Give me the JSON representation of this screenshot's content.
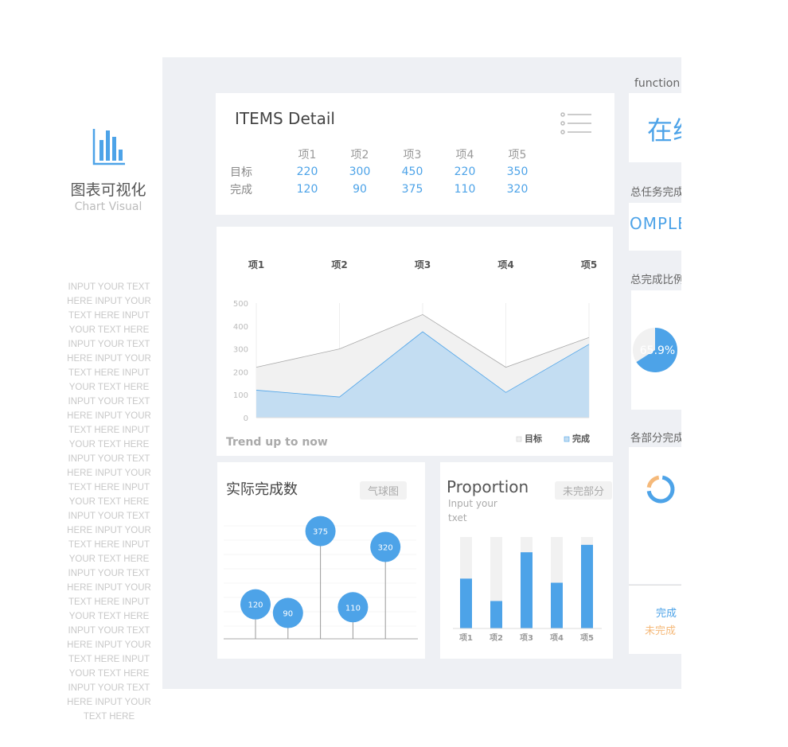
{
  "sidebar": {
    "title": "图表可视化",
    "subtitle": "Chart Visual",
    "icon": "bar-chart-icon",
    "body": "INPUT YOUR TEXT HERE INPUT YOUR TEXT HERE INPUT YOUR TEXT HERE INPUT YOUR TEXT HERE INPUT YOUR TEXT HERE INPUT YOUR TEXT HERE INPUT YOUR TEXT HERE INPUT YOUR TEXT HERE INPUT YOUR TEXT HERE INPUT YOUR TEXT HERE INPUT YOUR TEXT HERE INPUT YOUR TEXT HERE INPUT YOUR TEXT HERE INPUT YOUR TEXT HERE INPUT YOUR TEXT HERE INPUT YOUR TEXT HERE INPUT YOUR TEXT HERE INPUT YOUR TEXT HERE INPUT YOUR TEXT HERE INPUT YOUR TEXT HERE INPUT YOUR TEXT HERE INPUT YOUR TEXT HERE INPUT YOUR TEXT HERE"
  },
  "detail": {
    "title": "ITEMS Detail",
    "menu_icon": "list-menu-icon",
    "columns": [
      "项1",
      "项2",
      "项3",
      "项4",
      "项5"
    ],
    "rows": [
      {
        "label": "目标",
        "values": [
          "220",
          "300",
          "450",
          "220",
          "350"
        ]
      },
      {
        "label": "完成",
        "values": [
          "120",
          "90",
          "375",
          "110",
          "320"
        ]
      }
    ]
  },
  "colors": {
    "accent": "#4da3e8",
    "area_fill": "#c3ddf2",
    "target_fill": "#f1f1f1",
    "orange": "#f5b97a",
    "panel": "#eef0f4"
  },
  "right": {
    "function_label": "function",
    "online": "在线",
    "task_title": "总任务完成度",
    "complete": "COMPLETE",
    "ratio_title": "总完成比例",
    "pie_label": "65.9%",
    "parts_title": "各部分完成比例",
    "legend_done": "完成",
    "legend_undone": "未完成"
  },
  "chart_data": [
    {
      "type": "area",
      "categories": [
        "项1",
        "项2",
        "项3",
        "项4",
        "项5"
      ],
      "ylim": [
        0,
        500
      ],
      "yticks": [
        "0",
        "100",
        "200",
        "300",
        "400",
        "500"
      ],
      "series": [
        {
          "name": "目标",
          "values": [
            220,
            300,
            450,
            220,
            350
          ]
        },
        {
          "name": "完成",
          "values": [
            120,
            90,
            375,
            110,
            320
          ]
        }
      ],
      "footer": "Trend up to now",
      "legend": "bottom-right",
      "grid": "vertical"
    },
    {
      "type": "scatter",
      "title": "实际完成数",
      "tag": "气球图",
      "values": [
        120,
        90,
        375,
        110,
        320
      ],
      "labels": [
        "120",
        "90",
        "375",
        "110",
        "320"
      ]
    },
    {
      "type": "bar",
      "title": "Proportion",
      "subtitle": [
        "Input your",
        "txet"
      ],
      "tag": "未完部分",
      "categories": [
        "项1",
        "项2",
        "项3",
        "项4",
        "项5"
      ],
      "values": [
        0.545,
        0.3,
        0.833,
        0.5,
        0.914
      ]
    },
    {
      "type": "pie",
      "values": [
        65.9,
        34.1
      ]
    },
    {
      "type": "pie",
      "subtype": "donut",
      "values": [
        75,
        25
      ]
    }
  ]
}
